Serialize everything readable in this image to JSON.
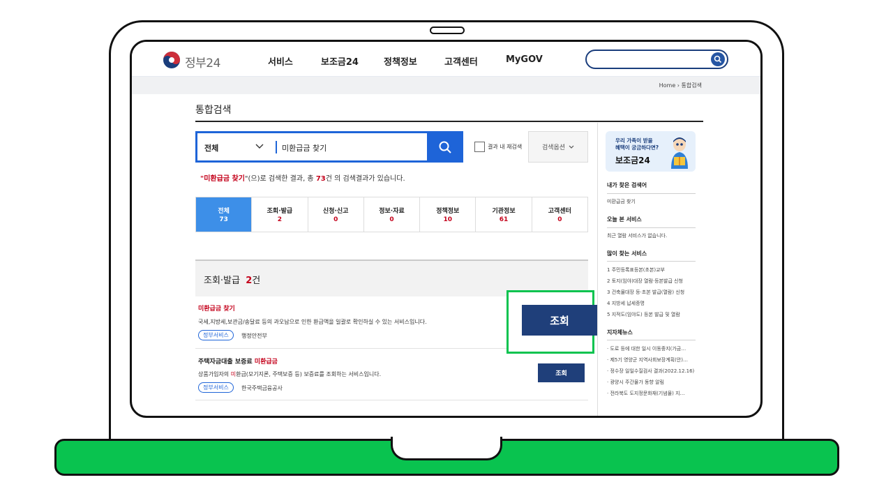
{
  "header": {
    "logo_text": "정부24",
    "nav": [
      "서비스",
      "보조금24",
      "정책정보",
      "고객센터",
      "MyGOV"
    ],
    "search_placeholder": ""
  },
  "breadcrumb": {
    "home": "Home",
    "current": "통합검색"
  },
  "page": {
    "title": "통합검색"
  },
  "search": {
    "category": "전체",
    "query": "미환급금 찾기",
    "within_label": "결과 내 재검색",
    "options_label": "검색옵션"
  },
  "summary": {
    "quote_open": "\"",
    "keyword": "미환급금 찾기",
    "mid": "\"(으)로 검색한 결과, 총 ",
    "count": "73",
    "tail": "건 의 검색결과가 있습니다."
  },
  "tabs": [
    {
      "label": "전체",
      "count": "73"
    },
    {
      "label": "조회·발급",
      "count": "2"
    },
    {
      "label": "신청·신고",
      "count": "0"
    },
    {
      "label": "정보·자료",
      "count": "0"
    },
    {
      "label": "정책정보",
      "count": "10"
    },
    {
      "label": "기관정보",
      "count": "61"
    },
    {
      "label": "고객센터",
      "count": "0"
    }
  ],
  "section": {
    "title": "조회·발급",
    "count": "2",
    "unit": "건"
  },
  "results": [
    {
      "title_prefix": "",
      "title_highlight": "미환급금 찾기",
      "desc": "국세,지방세,보관금/송달료 등의 과오납으로 인한 환급액을 일괄로 확인하실 수 있는 서비스입니다.",
      "tag": "정부서비스",
      "org": "행정안전부",
      "button": "조회"
    },
    {
      "title_prefix": "주택자금대출 보증료 ",
      "title_highlight": "미환급금",
      "desc_prefix": "상품가입자의 ",
      "desc_highlight": "미",
      "desc_suffix": "환급(모기지론, 주택보증 등) 보증료를 조회하는 서비스입니다.",
      "tag": "정부서비스",
      "org": "한국주택금융공사",
      "button": "조회"
    }
  ],
  "sidebar": {
    "banner_line1": "우리 가족이 받을",
    "banner_line2": "혜택이 궁금하다면?",
    "banner_title": "보조금24",
    "recent_search_title": "내가 찾은 검색어",
    "recent_search_items": [
      "미환급금 찾기"
    ],
    "today_title": "오늘 본 서비스",
    "today_items": [
      "최근 열람 서비스가 없습니다."
    ],
    "popular_title": "많이 찾는 서비스",
    "popular_items": [
      "주민등록표등본(초본)교부",
      "토지(임야)대장 열람·등본발급 신청",
      "건축물대장 등·초본 발급(열람) 신청",
      "지방세 납세증명",
      "지적도(임야도) 등본 발급 및 열람"
    ],
    "news_title": "지자체뉴스",
    "news_items": [
      "도로 등에 대한 일시 이동중지(가금…",
      "제5기 영양군 지역사회보장계획(안)…",
      "정수장 일일수질검사 결과(2022.12.16)",
      "광양시 주간물가 동향 알림",
      "전라북도 도지정문화재(기념물) 지…"
    ]
  },
  "highlight_button": "조회",
  "colors": {
    "accent": "#1e64d8",
    "button": "#1f3f7a",
    "highlight": "#09c34f",
    "emphasis": "#c4001a"
  }
}
